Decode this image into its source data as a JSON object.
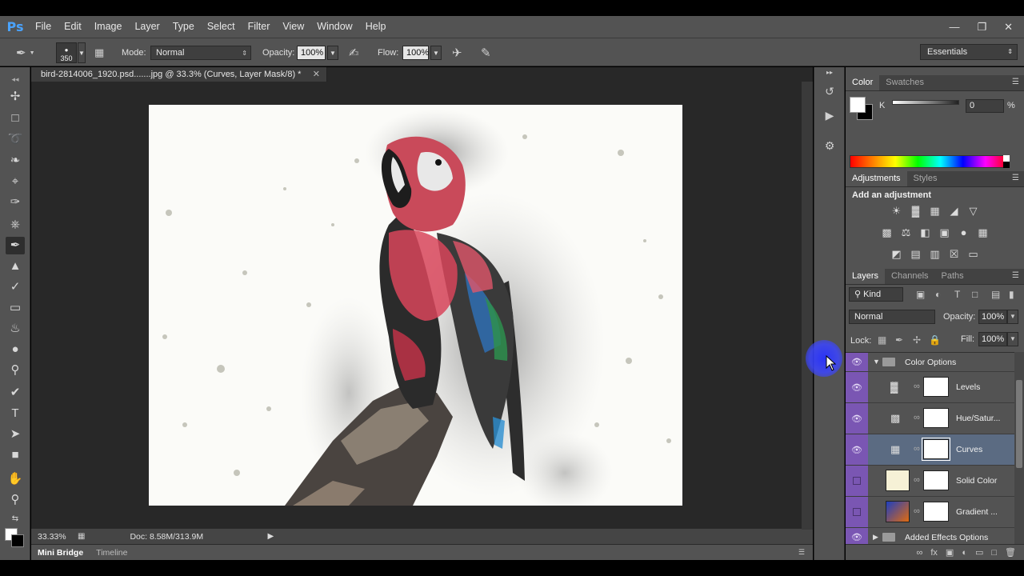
{
  "app": {
    "logo": "Ps"
  },
  "menu": [
    "File",
    "Edit",
    "Image",
    "Layer",
    "Type",
    "Select",
    "Filter",
    "View",
    "Window",
    "Help"
  ],
  "window_controls": [
    "minimize-icon",
    "restore-icon",
    "close-icon"
  ],
  "options_bar": {
    "brush_size": "350",
    "mode_label": "Mode:",
    "mode_value": "Normal",
    "opacity_label": "Opacity:",
    "opacity_value": "100%",
    "flow_label": "Flow:",
    "flow_value": "100%"
  },
  "workspace": "Essentials",
  "document": {
    "tab_title": "bird-2814006_1920.psd.......jpg @ 33.3% (Curves, Layer Mask/8) *",
    "zoom": "33.33%",
    "doc_size": "Doc: 8.58M/313.9M"
  },
  "bottom_tabs": [
    "Mini Bridge",
    "Timeline"
  ],
  "color_panel": {
    "tabs": [
      "Color",
      "Swatches"
    ],
    "channel_label": "K",
    "channel_value": "0",
    "unit": "%",
    "fg_color": "#ffffff",
    "bg_color": "#000000"
  },
  "adjustments_panel": {
    "tabs": [
      "Adjustments",
      "Styles"
    ],
    "title": "Add an adjustment"
  },
  "layers_panel": {
    "tabs": [
      "Layers",
      "Channels",
      "Paths"
    ],
    "filter_kind": "Kind",
    "blend_mode": "Normal",
    "opacity_label": "Opacity:",
    "opacity_value": "100%",
    "lock_label": "Lock:",
    "fill_label": "Fill:",
    "fill_value": "100%",
    "layers": [
      {
        "name": "Color Options",
        "type": "group",
        "visible": true,
        "expanded": true
      },
      {
        "name": "Levels",
        "type": "adjustment",
        "visible": true
      },
      {
        "name": "Hue/Satur...",
        "type": "adjustment",
        "visible": true
      },
      {
        "name": "Curves",
        "type": "adjustment",
        "visible": true,
        "selected": true
      },
      {
        "name": "Solid Color",
        "type": "fill",
        "visible": false,
        "swatch": "#f6f1d6"
      },
      {
        "name": "Gradient ...",
        "type": "fill",
        "visible": false,
        "swatch": "gradient"
      },
      {
        "name": "Added Effects Options",
        "type": "group",
        "visible": true,
        "expanded": false
      }
    ]
  },
  "colors": {
    "panel_bg": "#535353",
    "canvas_bg": "#282828",
    "eye_column": "#7a56b3",
    "selected_layer": "#5b6b82",
    "cursor_highlight": "#3c46ff"
  }
}
